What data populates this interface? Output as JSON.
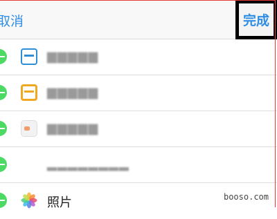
{
  "navbar": {
    "cancel_label": "取消",
    "done_label": "完成"
  },
  "rows": [
    {
      "icon": "calendar-icon",
      "label": "",
      "obscured": true
    },
    {
      "icon": "card-icon",
      "label": "",
      "obscured": true
    },
    {
      "icon": "wallet-icon",
      "label": "",
      "obscured": true
    },
    {
      "icon": "app-icon",
      "label": "",
      "obscured": true
    },
    {
      "icon": "photos-icon",
      "label": "照片",
      "obscured": false
    }
  ],
  "watermark": "booso.com",
  "colors": {
    "accent": "#2f8de4",
    "add_button": "#4cd964",
    "highlight_border": "#000000",
    "frame_border": "#e53935"
  }
}
